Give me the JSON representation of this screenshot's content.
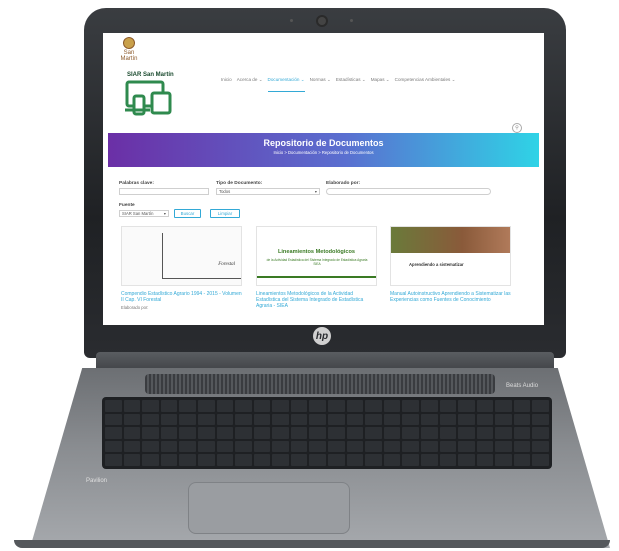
{
  "site": {
    "logo_text": "San Martín",
    "brand": "SIAR San Martín",
    "nav": [
      "Inicio",
      "Acerca de ⌄",
      "Documentación ⌄",
      "Normas ⌄",
      "Estadísticas ⌄",
      "Mapas ⌄",
      "Competencias Ambientales ⌄"
    ],
    "active_nav": "Documentación ⌄",
    "search_icon": "search-icon"
  },
  "hero": {
    "title": "Repositorio de Documentos",
    "breadcrumb": "Inicio  >  Documentación  >  Repositorio de Documentos"
  },
  "filters": {
    "keyword_label": "Palabras clave:",
    "keyword_value": "",
    "type_label": "Tipo de Documento:",
    "type_value": "Todos",
    "author_label": "Elaborado por:",
    "author_value": "",
    "source_label": "Fuente",
    "source_value": "SIAR San Martín",
    "search_button": "Buscar",
    "clear_button": "Limpiar"
  },
  "documents": [
    {
      "cover_text": "Forestal",
      "title": "Compendio Estadístico Agrario 1994 - 2015 - Volumen II Cap. VI Forestal",
      "author": "Elaborado por:"
    },
    {
      "cover_text": "Lineamientos Metodológicos",
      "cover_sub": "de la Actividad Estadística del Sistema Integrado de Estadística Agraria SIEA",
      "title": "Lineamientos Metodológicos de la Actividad Estadística del Sistema Integrado de Estadística Agraria - SIEA",
      "author": ""
    },
    {
      "cover_text": "Aprendiendo a sistematizar",
      "title": "Manual Autoinstructivo Aprendiendo a Sistematizar las Experiencias como Fuentes de Conocimiento",
      "author": ""
    }
  ],
  "laptop": {
    "bezel_logo": "hp",
    "base_label": "Pavilion",
    "badge": "Beats Audio"
  },
  "colors": {
    "accent": "#33a9d6",
    "hero_start": "#6b2fa6",
    "hero_end": "#2fd3e6"
  }
}
